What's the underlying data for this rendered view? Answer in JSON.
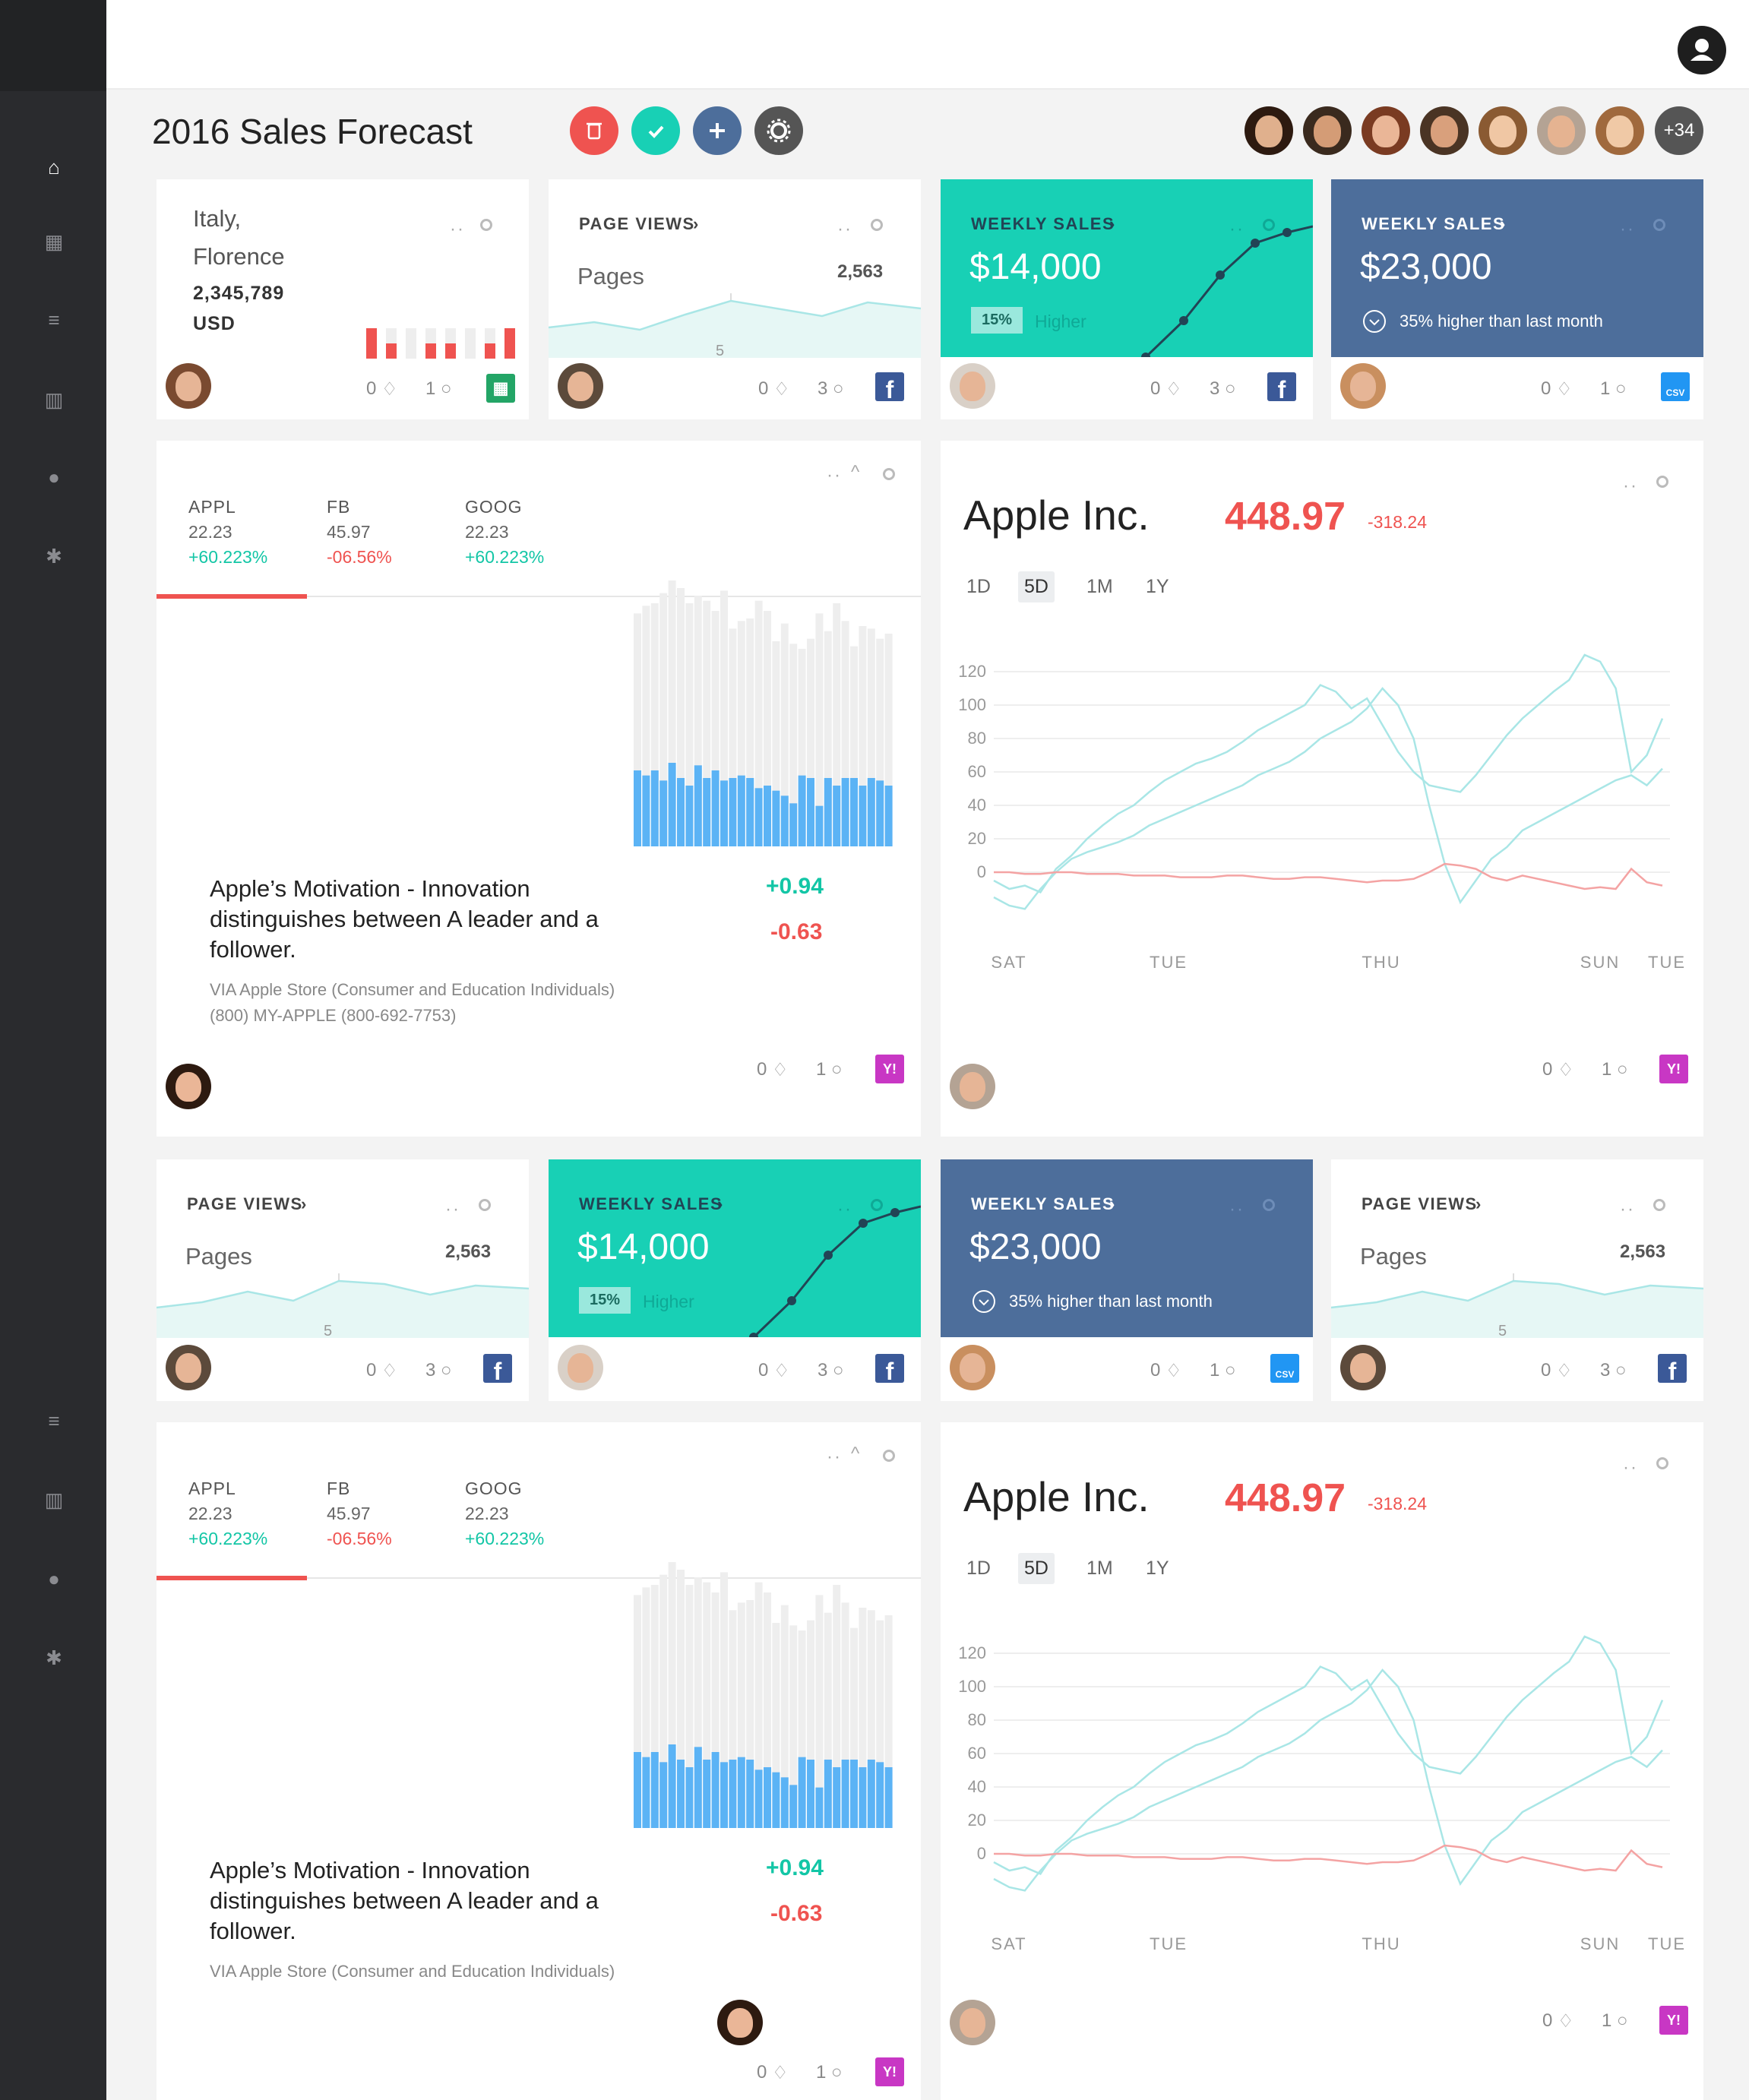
{
  "page_title": "2016 Sales Forecast",
  "extra_team_count": "+34",
  "colors": {
    "teal": "#18d0b5",
    "navy": "#4d6e9b",
    "red": "#ef5350",
    "blue_bar": "#5bb3f5"
  },
  "sidebar": {
    "icons": [
      "home-icon",
      "grid-icon",
      "database-icon",
      "chart-icon",
      "users-icon",
      "gear-icon",
      "database-icon",
      "chart-icon",
      "users-icon",
      "gear-icon"
    ]
  },
  "header_actions": [
    "trash-icon",
    "check-icon",
    "plus-icon",
    "gear-icon"
  ],
  "cards": {
    "location": {
      "line1": "Italy,",
      "line2": "Florence",
      "amount": "2,345,789",
      "currency": "USD",
      "alerts": "0",
      "comments": "1"
    },
    "pageviews": {
      "label": "PAGE VIEWS",
      "sub": "Pages",
      "value": "2,563",
      "axis": "5",
      "alerts": "0",
      "comments": "3"
    },
    "weekly_teal": {
      "label": "WEEKLY SALES",
      "amount": "$14,000",
      "pct": "15%",
      "note": "Higher",
      "alerts": "0",
      "comments": "3"
    },
    "weekly_navy": {
      "label": "WEEKLY SALES",
      "amount": "$23,000",
      "note": "35% higher than last month",
      "alerts": "0",
      "comments": "1"
    }
  },
  "stocks": [
    {
      "symbol": "APPL",
      "price": "22.23",
      "change": "+60.223%"
    },
    {
      "symbol": "FB",
      "price": "45.97",
      "change": "-06.56%"
    },
    {
      "symbol": "GOOG",
      "price": "22.23",
      "change": "+60.223%"
    }
  ],
  "story": {
    "headline": "Apple’s Motivation - Innovation distinguishes between A leader and a follower.",
    "via": "VIA Apple Store (Consumer and Education Individuals)",
    "phone": "(800) MY-APPLE (800-692-7753)",
    "delta_pos": "+0.94",
    "delta_neg": "-0.63",
    "alerts": "0",
    "comments": "1"
  },
  "quote": {
    "company": "Apple Inc.",
    "price": "448.97",
    "change": "-318.24",
    "ranges": [
      "1D",
      "5D",
      "1M",
      "1Y"
    ],
    "active_range": "5D",
    "alerts": "0",
    "comments": "1"
  },
  "chart_data": {
    "type": "line",
    "x_labels": [
      "SAT",
      "TUE",
      "THU",
      "SUN",
      "TUE"
    ],
    "y_ticks": [
      "120",
      "100",
      "80",
      "60",
      "40",
      "20",
      "0"
    ],
    "ylim": [
      -20,
      130
    ],
    "series": [
      {
        "color": "#a9e6e6",
        "values": [
          -5,
          -10,
          -8,
          -12,
          2,
          10,
          20,
          28,
          35,
          40,
          48,
          55,
          60,
          65,
          68,
          72,
          78,
          85,
          90,
          95,
          100,
          112,
          108,
          98,
          104,
          88,
          72,
          60,
          52,
          50,
          48,
          58,
          70,
          82,
          92,
          100,
          108,
          115,
          130,
          126,
          110,
          60,
          70,
          92
        ]
      },
      {
        "color": "#a9e6e6",
        "values": [
          -15,
          -20,
          -22,
          -10,
          0,
          8,
          12,
          15,
          18,
          22,
          28,
          32,
          36,
          40,
          44,
          48,
          52,
          58,
          62,
          66,
          72,
          80,
          85,
          90,
          98,
          110,
          100,
          80,
          40,
          5,
          -18,
          -5,
          8,
          15,
          25,
          30,
          35,
          40,
          45,
          50,
          55,
          58,
          52,
          62
        ]
      },
      {
        "color": "#f4a3a3",
        "values": [
          0,
          0,
          -1,
          -1,
          0,
          0,
          -1,
          -1,
          -1,
          -2,
          -2,
          -2,
          -3,
          -3,
          -3,
          -2,
          -2,
          -3,
          -4,
          -4,
          -3,
          -3,
          -4,
          -5,
          -6,
          -5,
          -5,
          -4,
          0,
          5,
          4,
          2,
          -3,
          -5,
          -2,
          -4,
          -6,
          -8,
          -10,
          -9,
          -10,
          2,
          -6,
          -8
        ]
      }
    ]
  },
  "bar_chart_data": {
    "type": "bar",
    "gray": [
      92,
      95,
      96,
      100,
      105,
      102,
      96,
      99,
      97,
      93,
      101,
      86,
      89,
      90,
      97,
      93,
      81,
      88,
      80,
      78,
      82,
      92,
      85,
      96,
      89,
      79,
      87,
      86,
      82,
      84,
      83,
      79,
      80,
      77
    ],
    "blue": [
      30,
      28,
      30,
      26,
      33,
      27,
      24,
      32,
      27,
      30,
      26,
      27,
      28,
      27,
      23,
      24,
      22,
      20,
      17,
      28,
      27,
      16,
      27,
      24,
      27,
      27,
      24,
      27,
      26,
      24,
      22,
      25,
      24,
      24
    ]
  },
  "bottom_row": [
    {
      "kind": "pageviews",
      "label": "PAGE VIEWS",
      "sub": "Pages",
      "value": "2,563",
      "axis": "5",
      "alerts": "0",
      "comments": "3"
    },
    {
      "kind": "teal",
      "label": "WEEKLY SALES",
      "amount": "$14,000",
      "pct": "15%",
      "note": "Higher",
      "alerts": "0",
      "comments": "3"
    },
    {
      "kind": "navy",
      "label": "WEEKLY SALES",
      "amount": "$23,000",
      "note": "35% higher than last month",
      "alerts": "0",
      "comments": "1"
    },
    {
      "kind": "pageviews",
      "label": "PAGE VIEWS",
      "sub": "Pages",
      "value": "2,563",
      "axis": "5",
      "alerts": "0",
      "comments": "3"
    }
  ]
}
